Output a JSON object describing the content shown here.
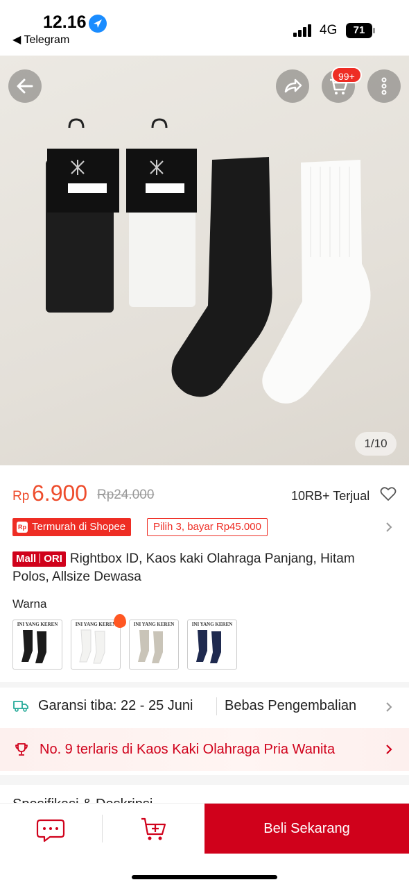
{
  "status_bar": {
    "time": "12.16",
    "back_app": "◀ Telegram",
    "network": "4G",
    "battery": "71"
  },
  "hero": {
    "image_counter": "1/10",
    "cart_badge": "99+",
    "icons": [
      "back-arrow-icon",
      "share-icon",
      "cart-icon",
      "more-icon"
    ]
  },
  "price": {
    "currency": "Rp",
    "current": "6.900",
    "original": "Rp24.000",
    "sold": "10RB+ Terjual"
  },
  "promos": {
    "cheapest": "Termurah di Shopee",
    "bundle": "Pilih 3, bayar Rp45.000"
  },
  "product": {
    "badge_mall": "Mall",
    "badge_ori": "ORI",
    "title": "Rightbox ID, Kaos kaki Olahraga Panjang, Hitam Polos, Allsize Dewasa"
  },
  "variants": {
    "label": "Warna",
    "items": [
      {
        "caption": "INI YANG KEREN",
        "color": "#1b1b1b"
      },
      {
        "caption": "INI YANG KEREN",
        "color": "#f3f3f1"
      },
      {
        "caption": "INI YANG KEREN",
        "color": "#c9c4b8"
      },
      {
        "caption": "INI YANG KEREN",
        "color": "#1f2a4f"
      }
    ]
  },
  "shipping": {
    "guarantee": "Garansi tiba: 22 - 25 Juni",
    "returns": "Bebas Pengembalian"
  },
  "ranking": {
    "text": "No. 9 terlaris di Kaos Kaki Olahraga Pria Wanita"
  },
  "spec_section": {
    "title": "Spesifikasi & Deskripsi"
  },
  "bottom_bar": {
    "buy_label": "Beli Sekarang"
  },
  "colors": {
    "accent": "#ee4d2d",
    "mall_red": "#d0011b"
  }
}
